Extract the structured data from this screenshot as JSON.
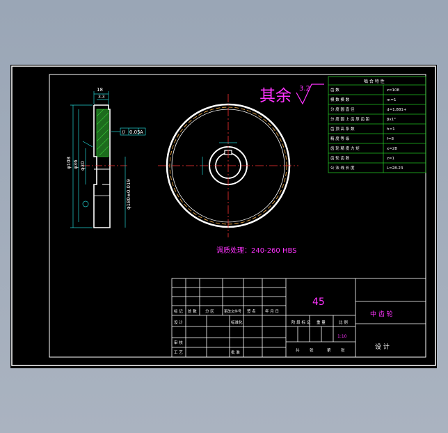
{
  "drawing": {
    "roughness_note": "其余",
    "roughness_value": "3.2",
    "heat_treatment": "调质处理：240-260  HBS",
    "dims": {
      "width_total": "18",
      "width_hub": "3.3",
      "dia_outer": "φ108",
      "dia_mid": "φ36",
      "dia_bore": "φ30",
      "dia_fit": "φ180±0.019",
      "tolerance_frame": [
        "//",
        "0.05",
        "A"
      ]
    }
  },
  "params_table": {
    "title": "啮 合 特 性",
    "rows": [
      {
        "label": "齿 数",
        "value": "z=108"
      },
      {
        "label": "模 数 模 数",
        "value": "m=1"
      },
      {
        "label": "分 度 圆 直 径",
        "value": "d=1.881+"
      },
      {
        "label": "分 度 圆 上 齿 厚 齿 距",
        "value": "βx1°"
      },
      {
        "label": "齿 顶 高 系 数",
        "value": "h=1"
      },
      {
        "label": "精 度 等 级",
        "value": "f=8"
      },
      {
        "label": "齿 轮 精 度 力 矩",
        "value": "x=28"
      },
      {
        "label": "齿 轮 齿 数",
        "value": "z=1"
      },
      {
        "label": "公 法 线 长 度",
        "value": "L=28.23"
      }
    ]
  },
  "title_block": {
    "material": "45",
    "part_name": "中 齿 轮",
    "scale": "1:10",
    "company": "设    计",
    "label_marks": [
      "标 记",
      "处 数",
      "分 区",
      "更改文件号",
      "签 名",
      "年 月 日"
    ],
    "label_design": "设 计",
    "label_standard": "标准化",
    "label_review": "审 核",
    "label_process": "工 艺",
    "label_approve": "批 准",
    "label_stage": "阶 段 标 记",
    "label_weight": "重 量",
    "label_ratio": "比 例",
    "label_sheets": [
      "共",
      "张",
      "第",
      "张"
    ]
  }
}
